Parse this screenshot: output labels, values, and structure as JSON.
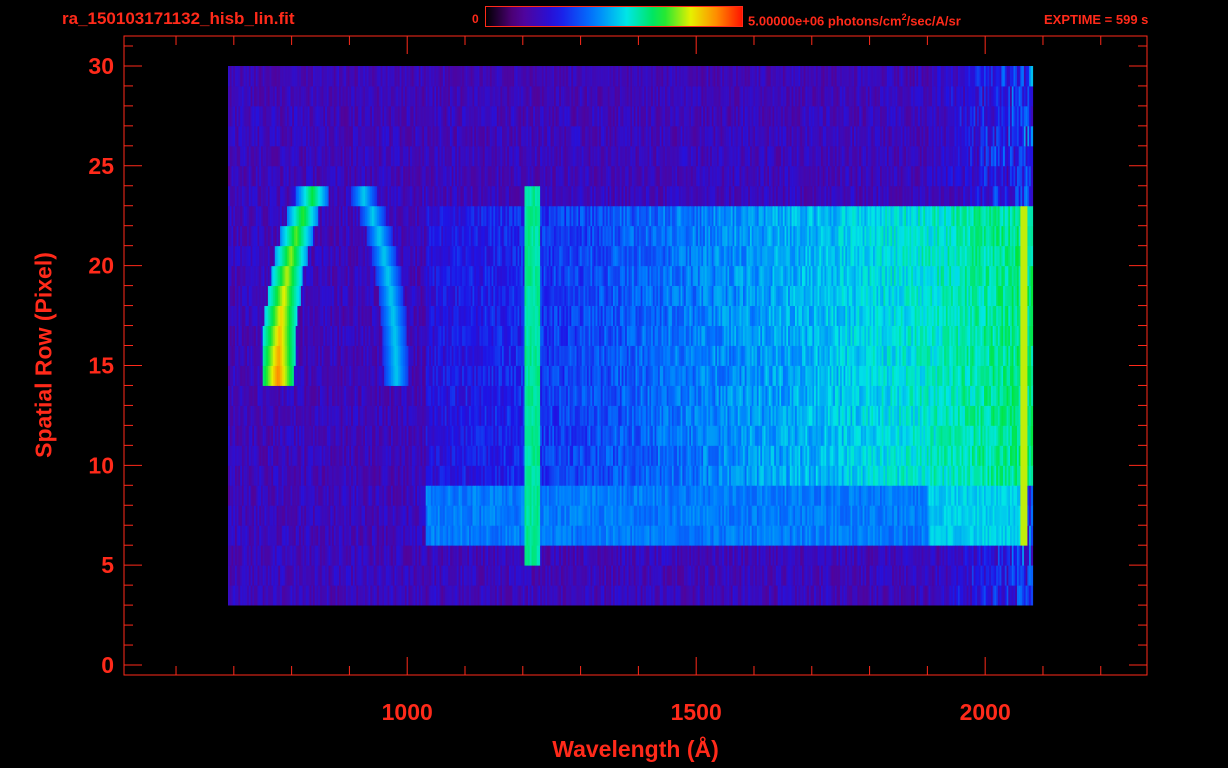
{
  "header": {
    "filename": "ra_150103171132_hisb_lin.fit",
    "colorbar_min": "0",
    "colorbar_max_prefix": "5.00000e+06 photons/cm",
    "colorbar_max_exp": "2",
    "colorbar_max_suffix": "/sec/A/sr",
    "exptime": "EXPTIME = 599 s"
  },
  "colors": {
    "axis": "#ff2a1a",
    "background": "#000000"
  },
  "chart_data": {
    "type": "heatmap",
    "title": "ra_150103171132_hisb_lin.fit",
    "xlabel": "Wavelength (Å)",
    "ylabel": "Spatial Row (Pixel)",
    "xlim": [
      510,
      2280
    ],
    "ylim": [
      -0.5,
      31.5
    ],
    "x_tick_labels": [
      "1000",
      "1500",
      "2000"
    ],
    "x_ticks": [
      1000,
      1500,
      2000
    ],
    "y_tick_labels": [
      "0",
      "5",
      "10",
      "15",
      "20",
      "25",
      "30"
    ],
    "y_ticks": [
      0,
      5,
      10,
      15,
      20,
      25,
      30
    ],
    "colorbar_range": [
      0,
      5000000
    ],
    "colormap": "rainbow",
    "features": [
      {
        "name": "arc",
        "x_range": [
          780,
          990
        ],
        "y_range": [
          13,
          24
        ],
        "peak": 0.85
      },
      {
        "name": "line",
        "x": 1215,
        "y_range": [
          5,
          24
        ],
        "peak": 0.5
      },
      {
        "name": "band",
        "x_range": [
          1030,
          2070
        ],
        "y_range": [
          6,
          9
        ],
        "peak": 0.45
      },
      {
        "name": "continuum",
        "x_range": [
          700,
          2070
        ],
        "y_range": [
          9,
          23
        ],
        "peak": 0.55
      }
    ]
  }
}
